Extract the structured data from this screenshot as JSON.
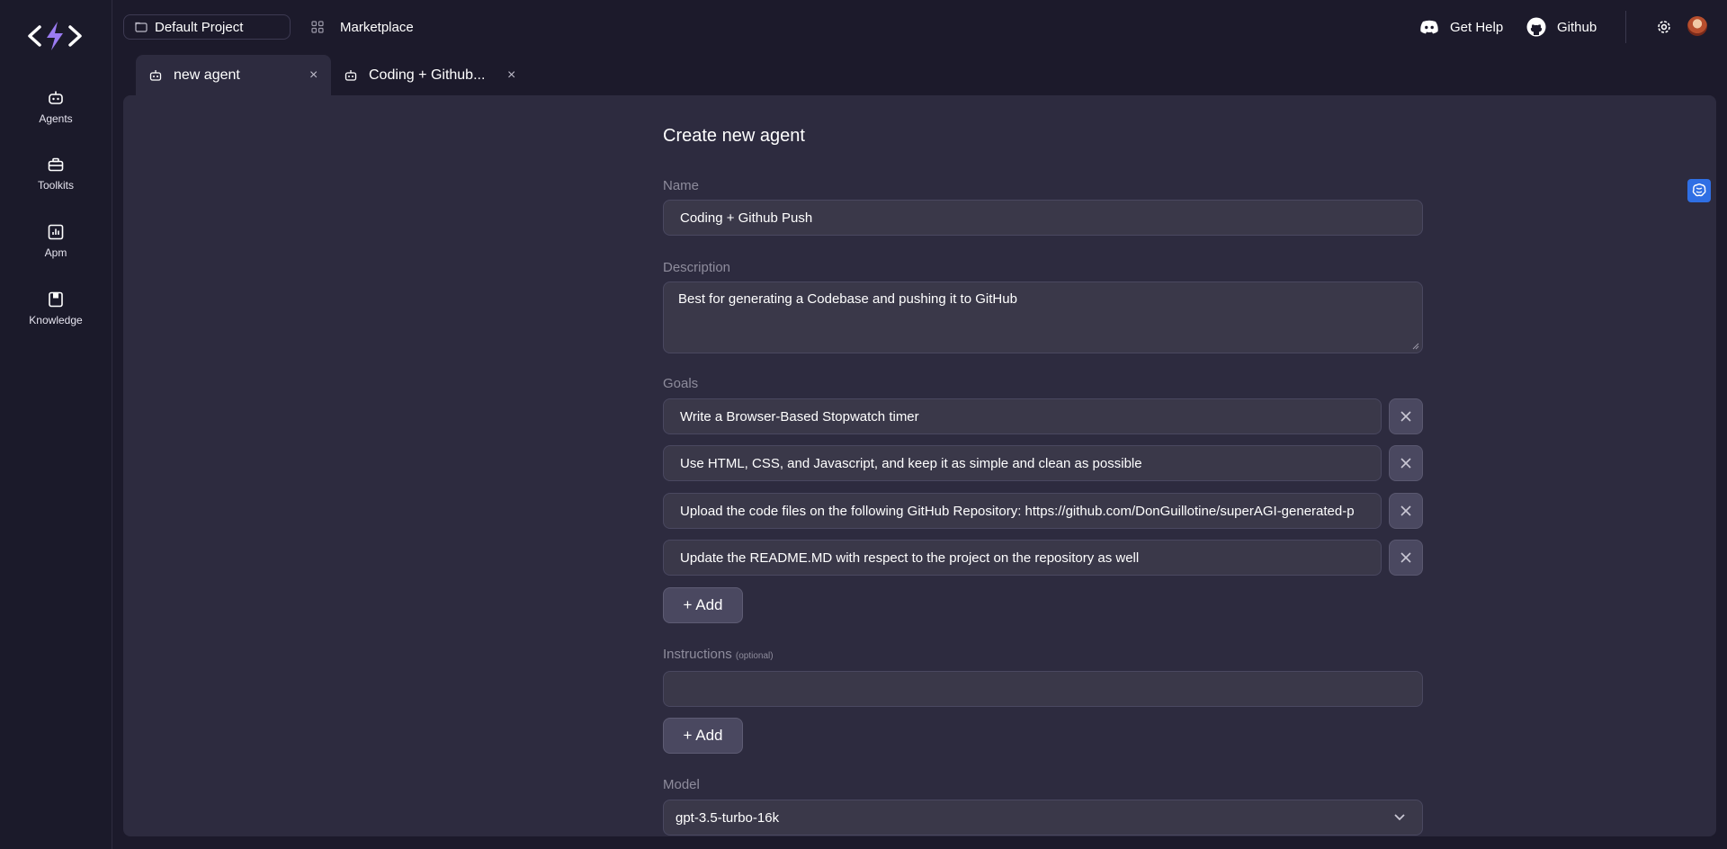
{
  "sidebar": {
    "items": [
      {
        "label": "Agents",
        "icon": "robot-icon"
      },
      {
        "label": "Toolkits",
        "icon": "toolbox-icon"
      },
      {
        "label": "Apm",
        "icon": "chart-icon"
      },
      {
        "label": "Knowledge",
        "icon": "book-icon"
      }
    ]
  },
  "topbar": {
    "project": "Default Project",
    "marketplace": "Marketplace",
    "help": "Get Help",
    "github": "Github"
  },
  "tabs": [
    {
      "label": "new agent",
      "active": true
    },
    {
      "label": "Coding + Github...",
      "active": false
    }
  ],
  "form": {
    "title": "Create new agent",
    "name_label": "Name",
    "name_value": "Coding + Github Push",
    "description_label": "Description",
    "description_value": "Best for generating a Codebase and pushing it to GitHub",
    "goals_label": "Goals",
    "goals": [
      "Write a Browser-Based Stopwatch timer",
      "Use HTML, CSS, and Javascript, and keep it as simple and clean as possible",
      "Upload the code files on the following GitHub Repository: https://github.com/DonGuillotine/superAGI-generated-p",
      "Update the README.MD with respect to the project on the repository as well"
    ],
    "add_label": "+ Add",
    "instructions_label": "Instructions",
    "instructions_optional": "(optional)",
    "instructions_value": "",
    "model_label": "Model",
    "model_value": "gpt-3.5-turbo-16k"
  },
  "colors": {
    "background": "#1c1a2b",
    "panel": "#2d2b3f",
    "input": "#3a3849",
    "accent": "#8b5cf6",
    "brain_badge": "#2f6fe4"
  }
}
